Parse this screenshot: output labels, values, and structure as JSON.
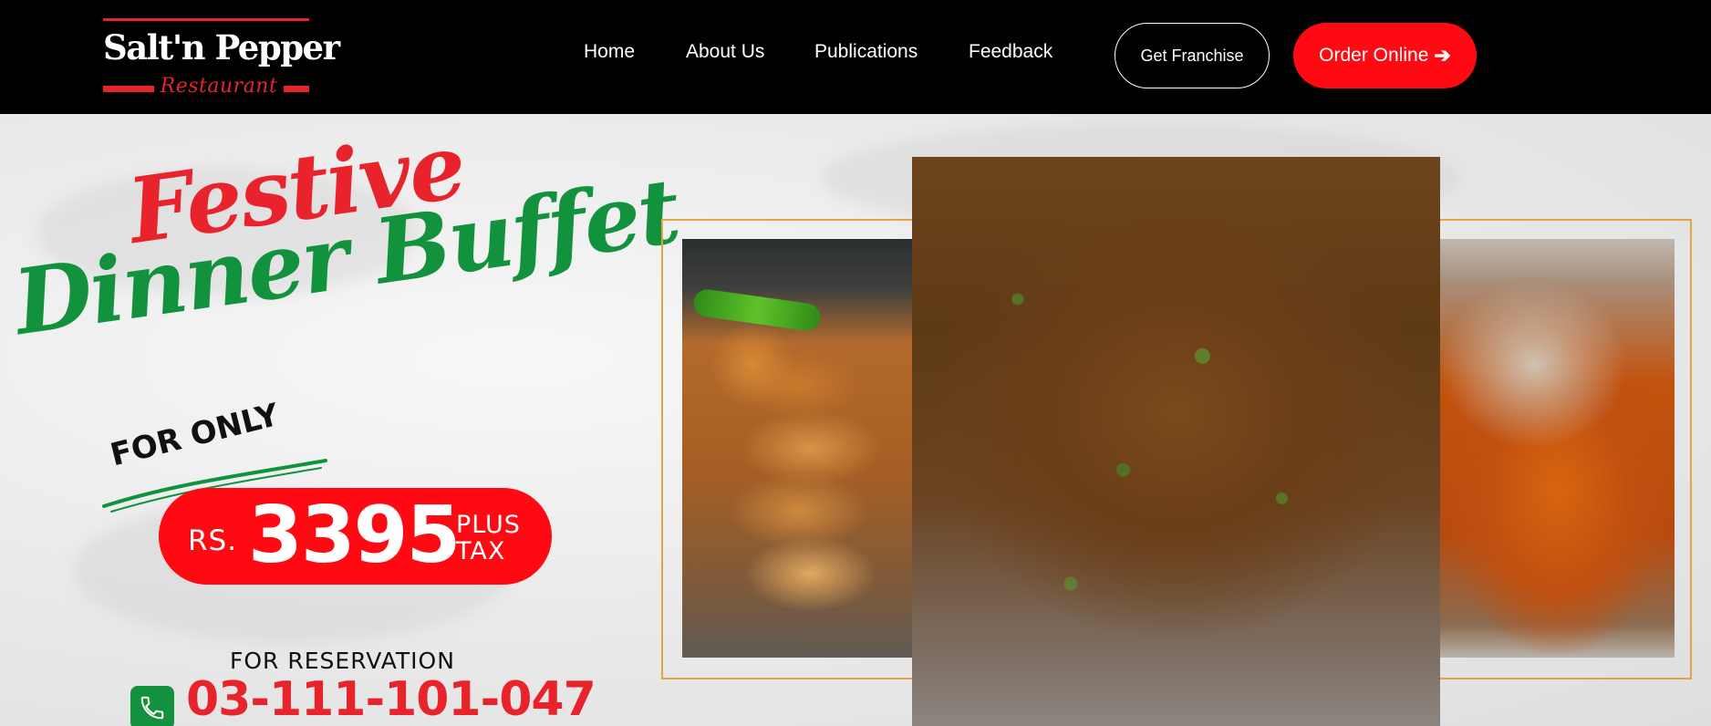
{
  "brand": {
    "name": "Salt'n Pepper",
    "subtitle": "Restaurant"
  },
  "nav": {
    "items": [
      "Home",
      "About Us",
      "Publications",
      "Feedback"
    ]
  },
  "buttons": {
    "franchise": "Get Franchise",
    "order": "Order Online",
    "order_icon": "arrow-right-icon"
  },
  "hero": {
    "title_line1": "Festive",
    "title_line2": "Dinner Buffet",
    "for_only": "FOR ONLY",
    "currency": "RS.",
    "price": "3395",
    "price_suffix_line1": "PLUS",
    "price_suffix_line2": "TAX",
    "reservation_label": "FOR RESERVATION",
    "phone": "03-111-101-047",
    "phone_icon": "phone-icon"
  },
  "colors": {
    "accent_red": "#ff0a12",
    "brand_red": "#e8232b",
    "brand_green": "#13923d",
    "frame_gold": "#e0a646",
    "header_bg": "#000000"
  }
}
